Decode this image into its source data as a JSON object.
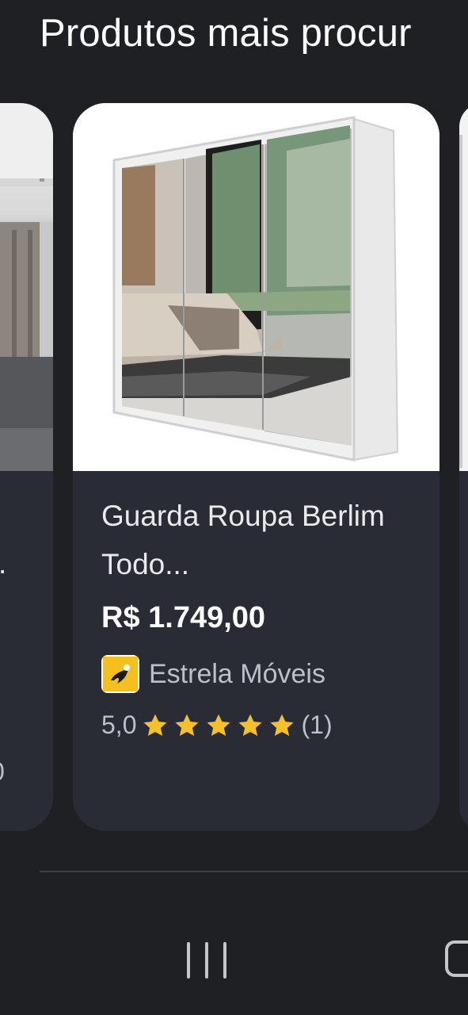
{
  "section": {
    "title": "Produtos mais procur"
  },
  "cards": {
    "left": {
      "title_fragment": ".",
      "rating_fragment": "0"
    },
    "main": {
      "image_icon": "wardrobe-mirror-photo",
      "title": "Guarda Roupa Berlim Todo...",
      "price": "R$ 1.749,00",
      "merchant": {
        "name": "Estrela Móveis",
        "logo_icon": "estrela-moveis-logo"
      },
      "rating": {
        "value_text": "5,0",
        "stars": 5,
        "count_text": "(1)"
      }
    }
  },
  "nav": {
    "recent_icon": "recent-apps-icon",
    "home_icon": "home-icon"
  },
  "colors": {
    "background": "#1f2024",
    "card": "#292c34",
    "star": "#f5c02a",
    "text_primary": "#e8eaed",
    "text_secondary": "#bdc1c6"
  }
}
